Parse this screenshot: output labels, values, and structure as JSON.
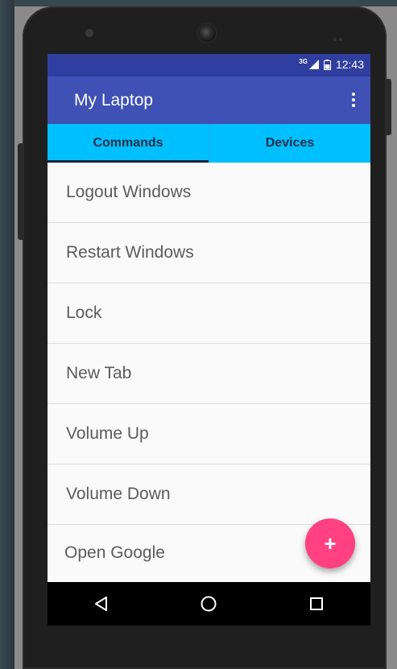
{
  "status_bar": {
    "network": "3G",
    "time": "12:43"
  },
  "app_bar": {
    "title": "My Laptop",
    "overflow_icon": "more-vert-icon"
  },
  "tabs": [
    {
      "label": "Commands",
      "selected": true
    },
    {
      "label": "Devices",
      "selected": false
    }
  ],
  "commands": [
    "Logout Windows",
    "Restart Windows",
    "Lock",
    "New Tab",
    "Volume Up",
    "Volume Down",
    "Open Google"
  ],
  "fab": {
    "label": "+",
    "icon": "add-icon"
  },
  "nav_bar": {
    "back_icon": "back-triangle-icon",
    "home_icon": "home-circle-icon",
    "recents_icon": "recents-square-icon"
  },
  "colors": {
    "status_bar": "#303f9f",
    "app_bar": "#3f51b5",
    "tab_bar": "#00bfff",
    "fab": "#ff4081"
  }
}
